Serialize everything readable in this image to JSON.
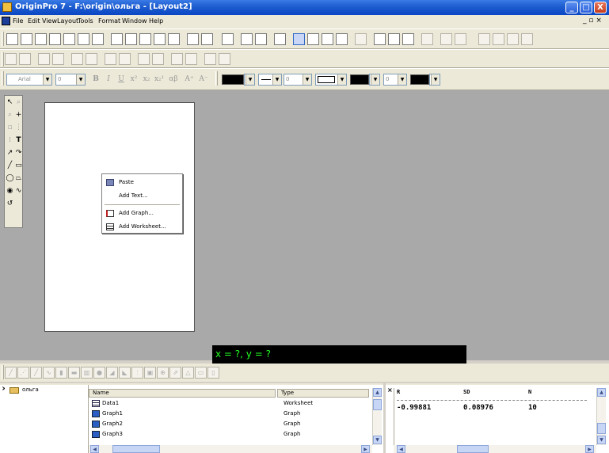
{
  "window": {
    "title": "OriginPro 7 - F:\\origin\\ольга - [Layout2]",
    "controls": {
      "minimize": "_",
      "maximize": "□",
      "close": "X"
    }
  },
  "menu": {
    "items": [
      "File",
      "Edit",
      "View",
      "Layout",
      "Tools",
      "Format",
      "Window",
      "Help"
    ],
    "mdi_controls": "_ ▫ ×"
  },
  "format_toolbar": {
    "font_family": "Arial",
    "font_size": "0",
    "bold": "B",
    "italic": "I",
    "underline": "U",
    "superscript": "x²",
    "subscript": "x₂",
    "sub_super": "x₂¹",
    "greek": "αβ",
    "increase_font": "A⁺",
    "decrease_font": "A⁻",
    "line_width": "0",
    "border_width": "0"
  },
  "workspace": {
    "coordinate_readout": "x = ?, y = ?"
  },
  "context_menu": {
    "items": [
      "Paste",
      "Add Text...",
      "Add Graph...",
      "Add Worksheet..."
    ]
  },
  "project_explorer": {
    "folder": "ольга",
    "columns": [
      "Name",
      "Type"
    ],
    "files": [
      {
        "name": "Data1",
        "type": "Worksheet"
      },
      {
        "name": "Graph1",
        "type": "Graph"
      },
      {
        "name": "Graph2",
        "type": "Graph"
      },
      {
        "name": "Graph3",
        "type": "Graph"
      }
    ]
  },
  "results": {
    "columns": [
      "R",
      "SD",
      "N"
    ],
    "values": [
      "-0.99881",
      "0.08976",
      "10"
    ]
  },
  "colors": {
    "title_bar": "#0a46c4",
    "workspace": "#a9a9a9",
    "coord_bg": "#000000",
    "coord_text": "#24ff24"
  }
}
